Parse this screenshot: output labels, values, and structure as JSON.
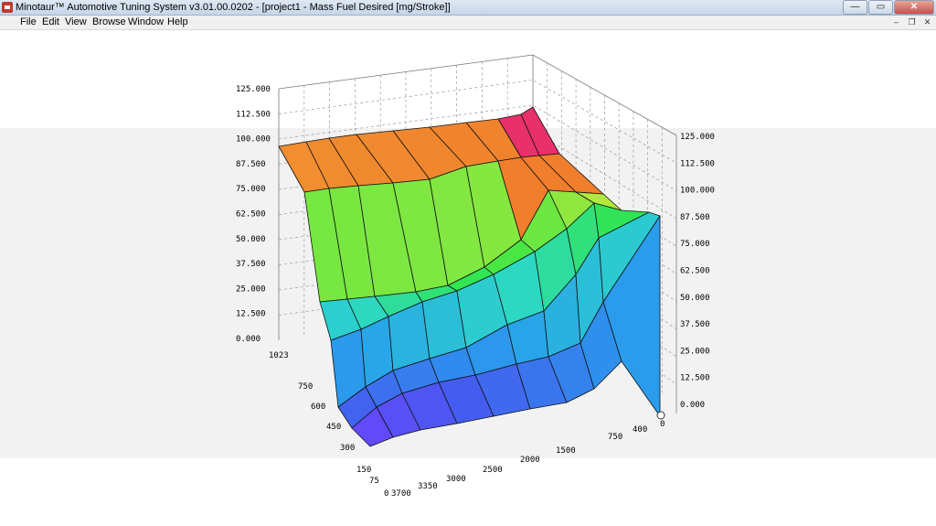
{
  "window": {
    "title": "Minotaur™ Automotive Tuning System  v3.01.00.0202 - [project1 - Mass Fuel Desired [mg/Stroke]]",
    "controls": {
      "minimize": "—",
      "maximize": "▭",
      "close": "✕"
    }
  },
  "menu": {
    "items": [
      "File",
      "Edit",
      "View",
      "Browse",
      "Window",
      "Help"
    ]
  },
  "mdi_controls": {
    "minimize": "–",
    "restore": "❐",
    "close": "✕"
  },
  "chart_data": {
    "type": "surface",
    "title": "",
    "z_ticks_left": [
      "125.000",
      "112.500",
      "100.000",
      "87.500",
      "75.000",
      "62.500",
      "50.000",
      "37.500",
      "25.000",
      "12.500",
      "0.000"
    ],
    "z_ticks_right": [
      "125.000",
      "112.500",
      "100.000",
      "87.500",
      "75.000",
      "62.500",
      "50.000",
      "37.500",
      "25.000",
      "12.500",
      "0.000"
    ],
    "axis_a_ticks": [
      "1023",
      "750",
      "600",
      "450",
      "300",
      "150",
      "75",
      "0"
    ],
    "axis_b_ticks": [
      "3700",
      "3350",
      "3000",
      "2500",
      "2000",
      "1500",
      "750",
      "400",
      "0"
    ],
    "zlim": [
      0,
      125
    ],
    "grid": true,
    "colors": {
      "high": "#e8306a",
      "mid": "#c8e83c",
      "low": "#7a3cff"
    }
  }
}
